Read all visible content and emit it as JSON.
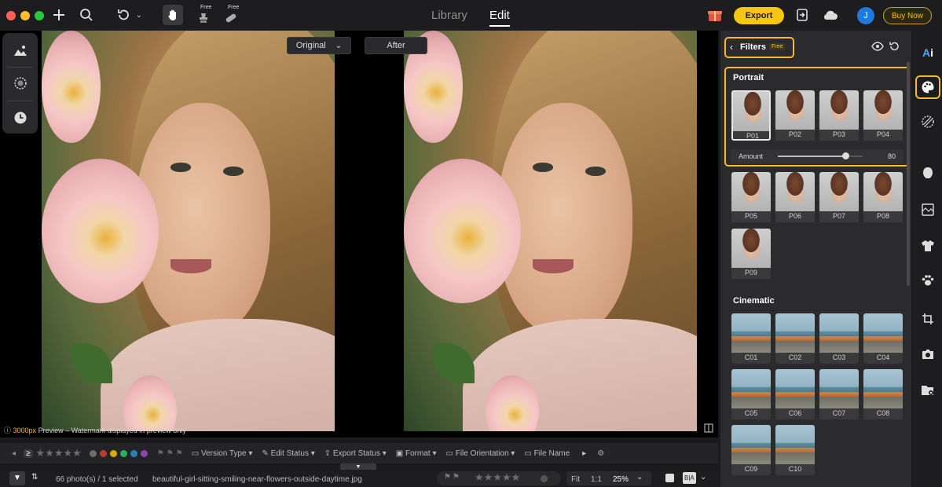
{
  "topbar": {
    "tabs": [
      {
        "label": "Library"
      },
      {
        "label": "Edit"
      }
    ],
    "free_tags": [
      "Free",
      "Free"
    ],
    "export_label": "Export",
    "avatar_letter": "J",
    "buy_label": "Buy Now"
  },
  "canvas": {
    "original_label": "Original",
    "after_label": "After",
    "watermark_size": "3000px",
    "watermark_text": "Preview – Watermark displayed in preview only"
  },
  "filterbar": {
    "ge_symbol": "≥",
    "label_colors": [
      "#6d6d6d",
      "#c0392b",
      "#d4ac0d",
      "#27ae60",
      "#2980b9",
      "#8e44ad"
    ],
    "version_type": "Version Type",
    "edit_status": "Edit Status",
    "export_status": "Export Status",
    "format": "Format",
    "file_orientation": "File Orientation",
    "file_name": "File Name"
  },
  "statusbar": {
    "count": "66 photo(s) / 1 selected",
    "filename": "beautiful-girl-sitting-smiling-near-flowers-outside-daytime.jpg",
    "fit": "Fit",
    "one_to_one": "1:1",
    "zoom": "25%",
    "ba": "B|A"
  },
  "panel": {
    "title": "Filters",
    "free_badge": "Free",
    "portrait": {
      "title": "Portrait",
      "items": [
        "P01",
        "P02",
        "P03",
        "P04",
        "P05",
        "P06",
        "P07",
        "P08",
        "P09"
      ],
      "selected": "P01",
      "amount_label": "Amount",
      "amount_value": "80",
      "amount_fraction": 0.8
    },
    "cinematic": {
      "title": "Cinematic",
      "items": [
        "C01",
        "C02",
        "C03",
        "C04",
        "C05",
        "C06",
        "C07",
        "C08",
        "C09",
        "C10"
      ]
    }
  },
  "colors": {
    "accent": "#f5b82e",
    "export_bg": "#f7c613",
    "avatar_bg": "#1f7ae0"
  }
}
